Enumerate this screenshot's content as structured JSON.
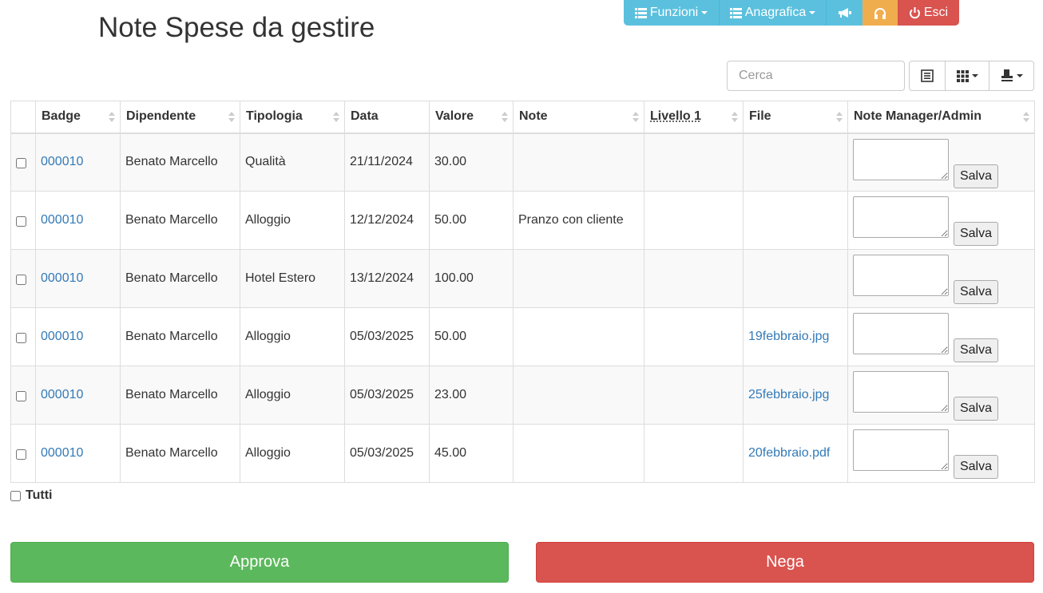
{
  "page_title": "Note Spese da gestire",
  "nav": {
    "funzioni": "Funzioni",
    "anagrafica": "Anagrafica",
    "esci": "Esci"
  },
  "search": {
    "placeholder": "Cerca"
  },
  "table": {
    "headers": [
      "Badge",
      "Dipendente",
      "Tipologia",
      "Data",
      "Valore",
      "Note",
      "Livello 1",
      "File",
      "Note Manager/Admin"
    ],
    "save_label": "Salva",
    "rows": [
      {
        "badge": "000010",
        "dipendente": "Benato Marcello",
        "tipologia": "Qualità",
        "data": "21/11/2024",
        "valore": "30.00",
        "note": "",
        "livello1": "",
        "file": ""
      },
      {
        "badge": "000010",
        "dipendente": "Benato Marcello",
        "tipologia": "Alloggio",
        "data": "12/12/2024",
        "valore": "50.00",
        "note": "Pranzo con cliente",
        "livello1": "",
        "file": ""
      },
      {
        "badge": "000010",
        "dipendente": "Benato Marcello",
        "tipologia": "Hotel Estero",
        "data": "13/12/2024",
        "valore": "100.00",
        "note": "",
        "livello1": "",
        "file": ""
      },
      {
        "badge": "000010",
        "dipendente": "Benato Marcello",
        "tipologia": "Alloggio",
        "data": "05/03/2025",
        "valore": "50.00",
        "note": "",
        "livello1": "",
        "file": "19febbraio.jpg"
      },
      {
        "badge": "000010",
        "dipendente": "Benato Marcello",
        "tipologia": "Alloggio",
        "data": "05/03/2025",
        "valore": "23.00",
        "note": "",
        "livello1": "",
        "file": "25febbraio.jpg"
      },
      {
        "badge": "000010",
        "dipendente": "Benato Marcello",
        "tipologia": "Alloggio",
        "data": "05/03/2025",
        "valore": "45.00",
        "note": "",
        "livello1": "",
        "file": "20febbraio.pdf"
      }
    ]
  },
  "select_all_label": "Tutti",
  "actions": {
    "approve": "Approva",
    "deny": "Nega"
  },
  "colors": {
    "info": "#5bc0de",
    "warning": "#f0ad4e",
    "danger": "#d9534f",
    "success": "#5cb85c",
    "link": "#337ab7"
  }
}
